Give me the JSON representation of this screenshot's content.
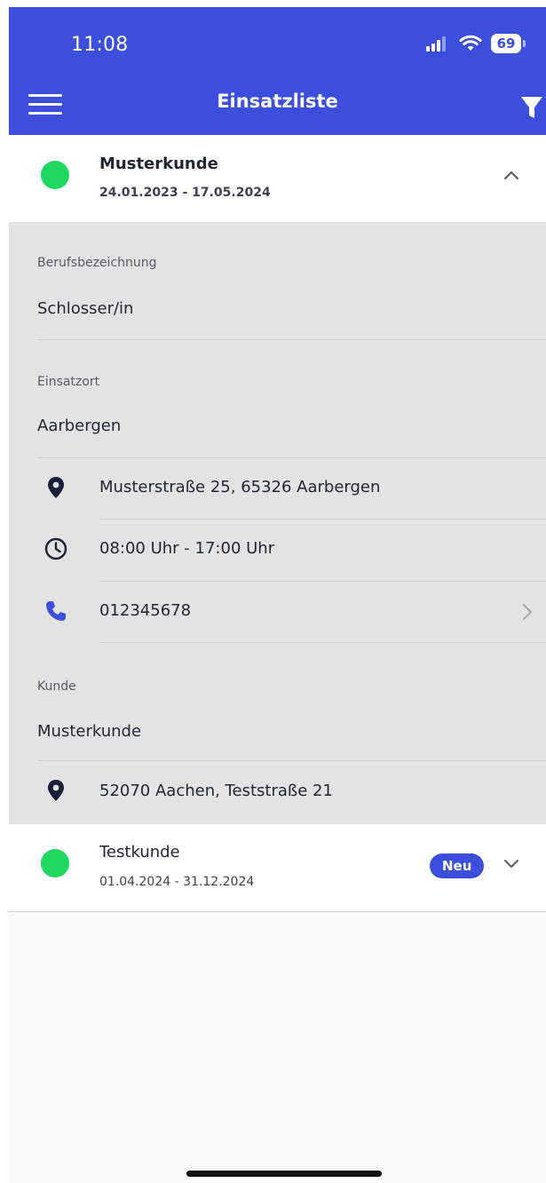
{
  "status_bar": {
    "time": "11:08",
    "battery": "69"
  },
  "nav": {
    "title": "Einsatzliste"
  },
  "assignments": [
    {
      "customer": "Musterkunde",
      "period": "24.01.2023 - 17.05.2024",
      "status_color": "#1ed760",
      "expanded": true,
      "details": {
        "job_title_label": "Berufsbezeichnung",
        "job_title": "Schlosser/in",
        "location_label": "Einsatzort",
        "location": "Aarbergen",
        "address": "Musterstraße 25, 65326 Aarbergen",
        "hours": "08:00 Uhr - 17:00 Uhr",
        "phone": "012345678",
        "customer_label": "Kunde",
        "customer_name": "Musterkunde",
        "customer_address": "52070 Aachen, Teststraße 21"
      }
    },
    {
      "customer": "Testkunde",
      "period": "01.04.2024 - 31.12.2024",
      "status_color": "#1ed760",
      "badge": "Neu",
      "expanded": false
    }
  ],
  "colors": {
    "accent": "#3c4fdc",
    "status_green": "#1ed760",
    "detail_bg": "#e3e3e3",
    "phone_icon": "#3c4fdc"
  }
}
